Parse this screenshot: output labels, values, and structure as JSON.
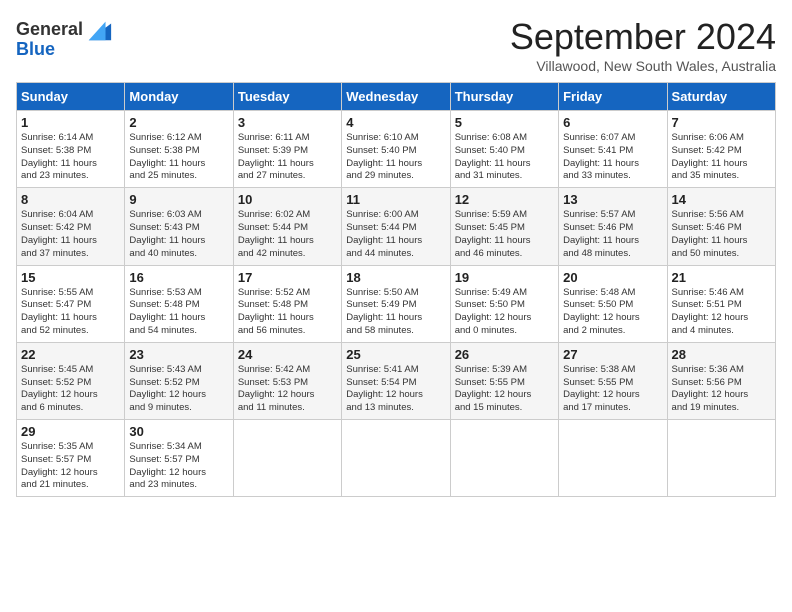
{
  "header": {
    "logo_line1": "General",
    "logo_line2": "Blue",
    "month_title": "September 2024",
    "location": "Villawood, New South Wales, Australia"
  },
  "calendar": {
    "days_of_week": [
      "Sunday",
      "Monday",
      "Tuesday",
      "Wednesday",
      "Thursday",
      "Friday",
      "Saturday"
    ],
    "weeks": [
      [
        {
          "day": "",
          "info": ""
        },
        {
          "day": "2",
          "info": "Sunrise: 6:12 AM\nSunset: 5:38 PM\nDaylight: 11 hours\nand 25 minutes."
        },
        {
          "day": "3",
          "info": "Sunrise: 6:11 AM\nSunset: 5:39 PM\nDaylight: 11 hours\nand 27 minutes."
        },
        {
          "day": "4",
          "info": "Sunrise: 6:10 AM\nSunset: 5:40 PM\nDaylight: 11 hours\nand 29 minutes."
        },
        {
          "day": "5",
          "info": "Sunrise: 6:08 AM\nSunset: 5:40 PM\nDaylight: 11 hours\nand 31 minutes."
        },
        {
          "day": "6",
          "info": "Sunrise: 6:07 AM\nSunset: 5:41 PM\nDaylight: 11 hours\nand 33 minutes."
        },
        {
          "day": "7",
          "info": "Sunrise: 6:06 AM\nSunset: 5:42 PM\nDaylight: 11 hours\nand 35 minutes."
        }
      ],
      [
        {
          "day": "1",
          "info": "Sunrise: 6:14 AM\nSunset: 5:38 PM\nDaylight: 11 hours\nand 23 minutes."
        },
        {
          "day": "9",
          "info": "Sunrise: 6:03 AM\nSunset: 5:43 PM\nDaylight: 11 hours\nand 40 minutes."
        },
        {
          "day": "10",
          "info": "Sunrise: 6:02 AM\nSunset: 5:44 PM\nDaylight: 11 hours\nand 42 minutes."
        },
        {
          "day": "11",
          "info": "Sunrise: 6:00 AM\nSunset: 5:44 PM\nDaylight: 11 hours\nand 44 minutes."
        },
        {
          "day": "12",
          "info": "Sunrise: 5:59 AM\nSunset: 5:45 PM\nDaylight: 11 hours\nand 46 minutes."
        },
        {
          "day": "13",
          "info": "Sunrise: 5:57 AM\nSunset: 5:46 PM\nDaylight: 11 hours\nand 48 minutes."
        },
        {
          "day": "14",
          "info": "Sunrise: 5:56 AM\nSunset: 5:46 PM\nDaylight: 11 hours\nand 50 minutes."
        }
      ],
      [
        {
          "day": "8",
          "info": "Sunrise: 6:04 AM\nSunset: 5:42 PM\nDaylight: 11 hours\nand 37 minutes."
        },
        {
          "day": "16",
          "info": "Sunrise: 5:53 AM\nSunset: 5:48 PM\nDaylight: 11 hours\nand 54 minutes."
        },
        {
          "day": "17",
          "info": "Sunrise: 5:52 AM\nSunset: 5:48 PM\nDaylight: 11 hours\nand 56 minutes."
        },
        {
          "day": "18",
          "info": "Sunrise: 5:50 AM\nSunset: 5:49 PM\nDaylight: 11 hours\nand 58 minutes."
        },
        {
          "day": "19",
          "info": "Sunrise: 5:49 AM\nSunset: 5:50 PM\nDaylight: 12 hours\nand 0 minutes."
        },
        {
          "day": "20",
          "info": "Sunrise: 5:48 AM\nSunset: 5:50 PM\nDaylight: 12 hours\nand 2 minutes."
        },
        {
          "day": "21",
          "info": "Sunrise: 5:46 AM\nSunset: 5:51 PM\nDaylight: 12 hours\nand 4 minutes."
        }
      ],
      [
        {
          "day": "15",
          "info": "Sunrise: 5:55 AM\nSunset: 5:47 PM\nDaylight: 11 hours\nand 52 minutes."
        },
        {
          "day": "23",
          "info": "Sunrise: 5:43 AM\nSunset: 5:52 PM\nDaylight: 12 hours\nand 9 minutes."
        },
        {
          "day": "24",
          "info": "Sunrise: 5:42 AM\nSunset: 5:53 PM\nDaylight: 12 hours\nand 11 minutes."
        },
        {
          "day": "25",
          "info": "Sunrise: 5:41 AM\nSunset: 5:54 PM\nDaylight: 12 hours\nand 13 minutes."
        },
        {
          "day": "26",
          "info": "Sunrise: 5:39 AM\nSunset: 5:55 PM\nDaylight: 12 hours\nand 15 minutes."
        },
        {
          "day": "27",
          "info": "Sunrise: 5:38 AM\nSunset: 5:55 PM\nDaylight: 12 hours\nand 17 minutes."
        },
        {
          "day": "28",
          "info": "Sunrise: 5:36 AM\nSunset: 5:56 PM\nDaylight: 12 hours\nand 19 minutes."
        }
      ],
      [
        {
          "day": "22",
          "info": "Sunrise: 5:45 AM\nSunset: 5:52 PM\nDaylight: 12 hours\nand 6 minutes."
        },
        {
          "day": "30",
          "info": "Sunrise: 5:34 AM\nSunset: 5:57 PM\nDaylight: 12 hours\nand 23 minutes."
        },
        {
          "day": "",
          "info": ""
        },
        {
          "day": "",
          "info": ""
        },
        {
          "day": "",
          "info": ""
        },
        {
          "day": "",
          "info": ""
        },
        {
          "day": "",
          "info": ""
        }
      ],
      [
        {
          "day": "29",
          "info": "Sunrise: 5:35 AM\nSunset: 5:57 PM\nDaylight: 12 hours\nand 21 minutes."
        },
        {
          "day": "",
          "info": ""
        },
        {
          "day": "",
          "info": ""
        },
        {
          "day": "",
          "info": ""
        },
        {
          "day": "",
          "info": ""
        },
        {
          "day": "",
          "info": ""
        },
        {
          "day": "",
          "info": ""
        }
      ]
    ]
  }
}
